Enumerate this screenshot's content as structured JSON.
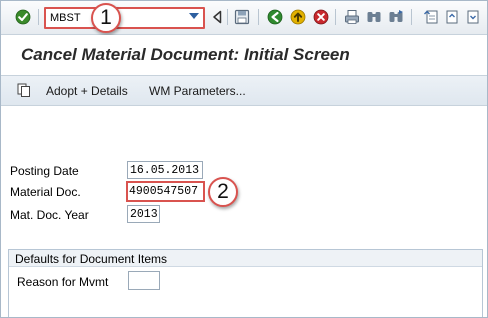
{
  "toolbar": {
    "command_value": "MBST",
    "callout_1": "1",
    "icons": [
      "enter-icon",
      "back-triangle-icon",
      "save-icon",
      "back-icon",
      "exit-icon",
      "cancel-icon",
      "print-icon",
      "find-icon",
      "find-next-icon",
      "first-page-icon",
      "previous-page-icon",
      "next-page-icon"
    ]
  },
  "title": "Cancel Material Document: Initial Screen",
  "app_toolbar": {
    "adopt_details": "Adopt + Details",
    "wm_parameters": "WM Parameters..."
  },
  "form": {
    "posting_date_label": "Posting Date",
    "posting_date_value": "16.05.2013",
    "material_doc_label": "Material Doc.",
    "material_doc_value": "4900547507",
    "callout_2": "2",
    "mat_doc_year_label": "Mat. Doc. Year",
    "mat_doc_year_value": "2013"
  },
  "defaults_group": {
    "title": "Defaults for Document Items",
    "reason_label": "Reason for Mvmt",
    "reason_value": ""
  },
  "colors": {
    "highlight": "#d9534f",
    "enter_green": "#3a8a2a",
    "nav_green": "#2f8a2f",
    "nav_yellow": "#e2b100",
    "cancel_red": "#c8282d"
  }
}
